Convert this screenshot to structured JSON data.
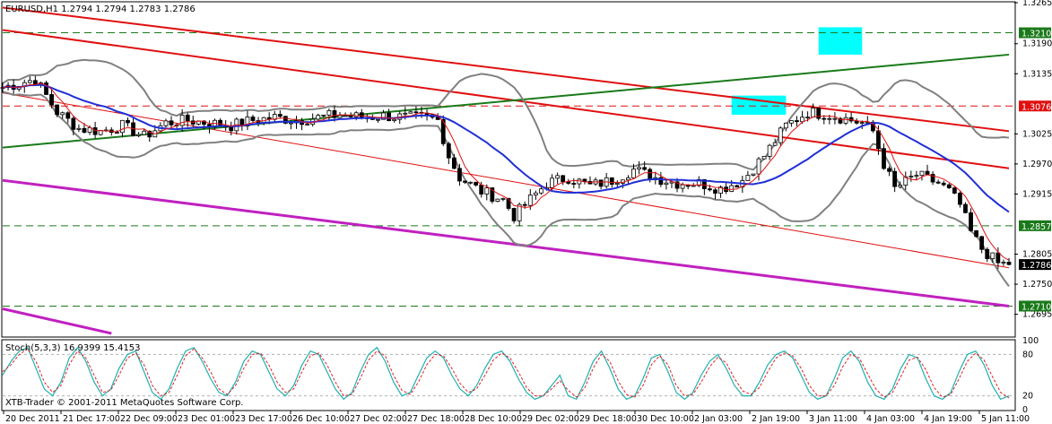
{
  "header": {
    "symbol_line": "EURUSD,H1  1.2794 1.2794 1.2783 1.2786",
    "osc_line": "Stoch(5,3,3) 16.9399 15.4153",
    "copyright": "XTB-Trader © 2001-2011 MetaQuotes Software Corp."
  },
  "colors": {
    "bullish_candle": "#ffffff",
    "bearish_candle": "#000000",
    "ma_blue": "#1f2fd6",
    "ma_red": "#e01010",
    "bands": "#808080",
    "trend_red": "#e01010",
    "trend_green": "#1a7a1a",
    "trend_magenta": "#c020c0",
    "zone_cyan": "#00ffff",
    "stoch_main": "#20b0b0",
    "stoch_signal": "#e02020"
  },
  "chart_data": [
    {
      "type": "candlestick",
      "symbol": "EURUSD",
      "timeframe": "H1",
      "last_ohlc": {
        "open": 1.2794,
        "high": 1.2794,
        "low": 1.2783,
        "close": 1.2786
      },
      "ylim": [
        1.2655,
        1.3265
      ],
      "y_ticks": [
        "1.3265",
        "1.3190",
        "1.3135",
        "1.3025",
        "1.2970",
        "1.2915",
        "1.2805",
        "1.2750",
        "1.2695"
      ],
      "x_ticks": [
        "20 Dec 2011",
        "21 Dec 17:00",
        "22 Dec 09:00",
        "23 Dec 01:00",
        "23 Dec 17:00",
        "26 Dec 10:00",
        "27 Dec 02:00",
        "27 Dec 18:00",
        "28 Dec 10:00",
        "29 Dec 02:00",
        "29 Dec 18:00",
        "30 Dec 10:00",
        "2 Jan 03:00",
        "2 Jan 19:00",
        "3 Jan 11:00",
        "4 Jan 03:00",
        "4 Jan 19:00",
        "5 Jan 11:00"
      ],
      "price_labels": [
        {
          "value": "1.3210",
          "bg": "#1a7a1a"
        },
        {
          "value": "1.3076",
          "bg": "#e01010"
        },
        {
          "value": "1.2857",
          "bg": "#1a7a1a"
        },
        {
          "value": "1.2786",
          "bg": "#000000"
        },
        {
          "value": "1.2710",
          "bg": "#1a7a1a"
        }
      ],
      "horizontal_levels": [
        {
          "price": 1.321,
          "color": "#1a7a1a",
          "style": "dashed"
        },
        {
          "price": 1.3076,
          "color": "#e01010",
          "style": "dashed"
        },
        {
          "price": 1.2857,
          "color": "#1a7a1a",
          "style": "dashed"
        },
        {
          "price": 1.271,
          "color": "#1a7a1a",
          "style": "dashed"
        }
      ],
      "price_path": [
        [
          0,
          1.311
        ],
        [
          6,
          1.3125
        ],
        [
          10,
          1.3065
        ],
        [
          14,
          1.3035
        ],
        [
          18,
          1.303
        ],
        [
          22,
          1.304
        ],
        [
          26,
          1.302
        ],
        [
          30,
          1.3045
        ],
        [
          34,
          1.305
        ],
        [
          38,
          1.3045
        ],
        [
          42,
          1.304
        ],
        [
          46,
          1.305
        ],
        [
          50,
          1.3055
        ],
        [
          54,
          1.305
        ],
        [
          58,
          1.3055
        ],
        [
          62,
          1.306
        ],
        [
          66,
          1.3055
        ],
        [
          70,
          1.3058
        ],
        [
          74,
          1.3055
        ],
        [
          78,
          1.3055
        ],
        [
          80,
          1.305
        ],
        [
          82,
          1.2985
        ],
        [
          84,
          1.2945
        ],
        [
          88,
          1.292
        ],
        [
          92,
          1.2905
        ],
        [
          94,
          1.2875
        ],
        [
          96,
          1.2895
        ],
        [
          100,
          1.2935
        ],
        [
          104,
          1.2945
        ],
        [
          108,
          1.293
        ],
        [
          112,
          1.294
        ],
        [
          116,
          1.296
        ],
        [
          120,
          1.2945
        ],
        [
          124,
          1.2935
        ],
        [
          128,
          1.2935
        ],
        [
          132,
          1.2925
        ],
        [
          136,
          1.294
        ],
        [
          140,
          1.2985
        ],
        [
          144,
          1.304
        ],
        [
          148,
          1.3065
        ],
        [
          152,
          1.306
        ],
        [
          156,
          1.305
        ],
        [
          158,
          1.3045
        ],
        [
          160,
          1.303
        ],
        [
          162,
          1.297
        ],
        [
          164,
          1.2925
        ],
        [
          168,
          1.295
        ],
        [
          172,
          1.2935
        ],
        [
          174,
          1.292
        ],
        [
          176,
          1.2895
        ],
        [
          178,
          1.2845
        ],
        [
          180,
          1.2815
        ],
        [
          183,
          1.2788
        ],
        [
          185,
          1.2786
        ]
      ],
      "zones": [
        {
          "x_from": 150,
          "x_to": 158,
          "price_from": 1.317,
          "price_to": 1.322,
          "color": "#00ffff"
        },
        {
          "x_from": 134,
          "x_to": 144,
          "price_from": 1.306,
          "price_to": 1.3095,
          "color": "#00ffff"
        }
      ]
    },
    {
      "type": "line",
      "name": "Stoch(5,3,3)",
      "main_value": 16.9399,
      "signal_value": 15.4153,
      "ylim": [
        0,
        100
      ],
      "y_ticks": [
        "100",
        "80",
        "20",
        "0"
      ],
      "main": [
        50,
        70,
        85,
        90,
        60,
        30,
        20,
        40,
        75,
        90,
        70,
        40,
        20,
        30,
        60,
        80,
        85,
        55,
        25,
        15,
        30,
        60,
        85,
        90,
        70,
        45,
        25,
        20,
        40,
        70,
        85,
        80,
        55,
        30,
        20,
        35,
        65,
        85,
        80,
        55,
        30,
        15,
        25,
        55,
        80,
        90,
        70,
        40,
        20,
        25,
        50,
        75,
        85,
        75,
        50,
        30,
        20,
        35,
        60,
        80,
        85,
        70,
        45,
        25,
        15,
        20,
        35,
        50,
        20,
        15,
        40,
        70,
        85,
        60,
        30,
        15,
        20,
        45,
        75,
        80,
        55,
        25,
        15,
        25,
        50,
        70,
        80,
        60,
        35,
        20,
        20,
        40,
        65,
        80,
        85,
        75,
        50,
        25,
        15,
        20,
        45,
        75,
        85,
        70,
        40,
        20,
        15,
        30,
        60,
        80,
        75,
        45,
        20,
        15,
        25,
        55,
        80,
        85,
        65,
        35,
        15,
        20
      ],
      "signal": [
        55,
        65,
        80,
        88,
        70,
        40,
        25,
        35,
        65,
        85,
        75,
        50,
        25,
        28,
        50,
        75,
        82,
        65,
        35,
        20,
        25,
        50,
        78,
        88,
        75,
        55,
        30,
        22,
        35,
        60,
        80,
        82,
        65,
        40,
        25,
        30,
        55,
        78,
        82,
        65,
        40,
        20,
        22,
        45,
        72,
        85,
        78,
        50,
        28,
        22,
        40,
        65,
        80,
        78,
        60,
        38,
        25,
        30,
        50,
        72,
        82,
        75,
        55,
        32,
        20,
        20,
        30,
        42,
        28,
        18,
        32,
        60,
        80,
        70,
        42,
        22,
        18,
        35,
        65,
        78,
        65,
        35,
        20,
        22,
        40,
        62,
        76,
        68,
        45,
        27,
        22,
        32,
        55,
        75,
        82,
        78,
        60,
        35,
        20,
        20,
        35,
        62,
        80,
        75,
        52,
        30,
        18,
        25,
        48,
        72,
        76,
        58,
        32,
        18,
        22,
        45,
        70,
        82,
        72,
        48,
        25,
        17
      ]
    }
  ]
}
